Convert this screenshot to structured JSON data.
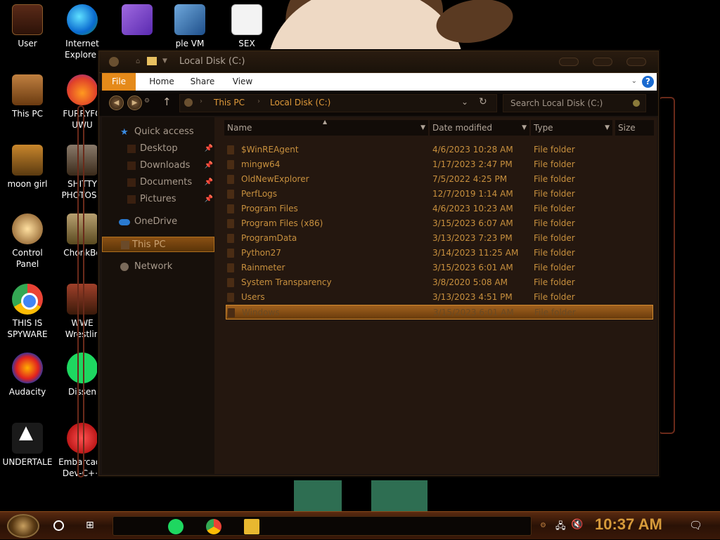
{
  "desktop": {
    "icons": [
      {
        "label": "User",
        "icon": "user-icon"
      },
      {
        "label": "Internet Explorer",
        "icon": "edge-icon"
      },
      {
        "label": "",
        "icon": "visual-studio-icon"
      },
      {
        "label": "ple VM",
        "icon": "virtualbox-icon"
      },
      {
        "label": "SEX",
        "icon": "hxd-icon"
      },
      {
        "label": "This PC",
        "icon": "this-pc-icon"
      },
      {
        "label": "FURRYFO UWU",
        "icon": "firefox-icon"
      },
      {
        "label": "moon girl",
        "icon": "moon-girl-icon"
      },
      {
        "label": "SHITTY PHOTOSH",
        "icon": "gimp-icon"
      },
      {
        "label": "Control Panel",
        "icon": "control-panel-icon"
      },
      {
        "label": "ChonkBo",
        "icon": "chonkbox-icon"
      },
      {
        "label": "THIS IS SPYWARE",
        "icon": "chrome-icon"
      },
      {
        "label": "WWE Wrestlin",
        "icon": "wwe-icon"
      },
      {
        "label": "Audacity",
        "icon": "audacity-icon"
      },
      {
        "label": "Dissen",
        "icon": "spotify-icon"
      },
      {
        "label": "UNDERTALE",
        "icon": "unity-icon"
      },
      {
        "label": "Embarcade Dev-C++",
        "icon": "devcpp-icon"
      }
    ]
  },
  "explorer": {
    "title": "Local Disk (C:)",
    "ribbon": {
      "tabs": [
        "File",
        "Home",
        "Share",
        "View"
      ],
      "help_label": "?"
    },
    "address": {
      "crumbs": [
        "This PC",
        "Local Disk (C:)"
      ]
    },
    "search": {
      "placeholder": "Search Local Disk (C:)"
    },
    "nav": {
      "quick_access": "Quick access",
      "quick_items": [
        "Desktop",
        "Downloads",
        "Documents",
        "Pictures"
      ],
      "onedrive": "OneDrive",
      "this_pc": "This PC",
      "network": "Network"
    },
    "columns": [
      "Name",
      "Date modified",
      "Type",
      "Size"
    ],
    "files": [
      {
        "name": "$WinREAgent",
        "date": "4/6/2023 10:28 AM",
        "type": "File folder"
      },
      {
        "name": "mingw64",
        "date": "1/17/2023 2:47 PM",
        "type": "File folder"
      },
      {
        "name": "OldNewExplorer",
        "date": "7/5/2022 4:25 PM",
        "type": "File folder"
      },
      {
        "name": "PerfLogs",
        "date": "12/7/2019 1:14 AM",
        "type": "File folder"
      },
      {
        "name": "Program Files",
        "date": "4/6/2023 10:23 AM",
        "type": "File folder"
      },
      {
        "name": "Program Files (x86)",
        "date": "3/15/2023 6:07 AM",
        "type": "File folder"
      },
      {
        "name": "ProgramData",
        "date": "3/13/2023 7:23 PM",
        "type": "File folder"
      },
      {
        "name": "Python27",
        "date": "3/14/2023 11:25 AM",
        "type": "File folder"
      },
      {
        "name": "Rainmeter",
        "date": "3/15/2023 6:01 AM",
        "type": "File folder"
      },
      {
        "name": "System Transparency",
        "date": "3/8/2020 5:08 AM",
        "type": "File folder"
      },
      {
        "name": "Users",
        "date": "3/13/2023 4:51 PM",
        "type": "File folder"
      },
      {
        "name": "Windows",
        "date": "3/15/2023 6:01 AM",
        "type": "File folder"
      }
    ],
    "selected_file": "Windows"
  },
  "taskbar": {
    "pinned": [
      "spotify-icon",
      "chrome-icon",
      "file-explorer-icon"
    ],
    "clock": "10:37 AM"
  },
  "colors": {
    "accent": "#e58a1a",
    "folder_text": "#c8903e",
    "clock": "#d69a3a"
  }
}
